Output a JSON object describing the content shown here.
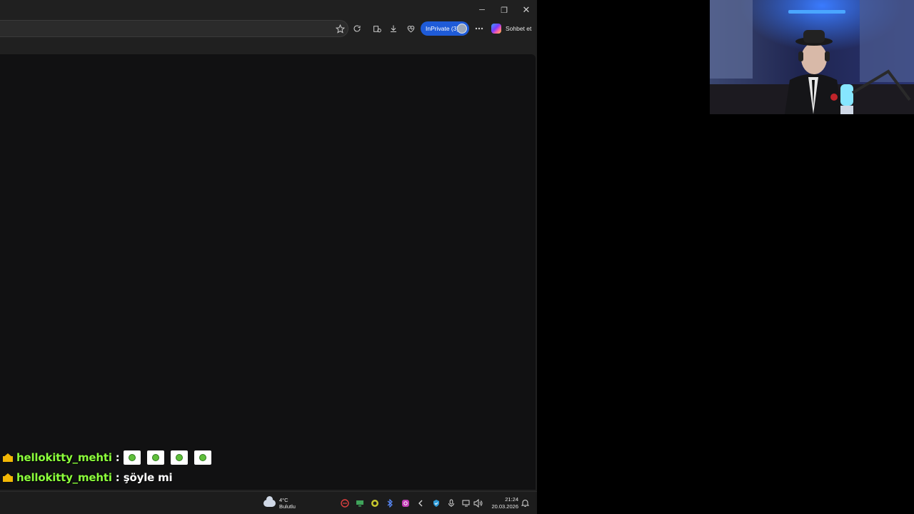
{
  "browser": {
    "window_controls": {
      "minimize": "─",
      "maximize": "❐",
      "close": "✕"
    },
    "toolbar": {
      "inprivate_label": "InPrivate (3)",
      "chat_label": "Sohbet et",
      "icons": [
        "favorite-star-icon",
        "refresh-ext-icon",
        "collections-icon",
        "download-icon",
        "heart-pulse-icon",
        "more-icon"
      ]
    }
  },
  "chat": {
    "messages": [
      {
        "username": "hellokitty_mehti",
        "separator": ":",
        "emote_count": 4
      },
      {
        "username": "hellokitty_mehti",
        "separator": ":",
        "text": "şöyle mi"
      }
    ]
  },
  "taskbar": {
    "weather": {
      "temp": "4°C",
      "condition": "Bulutlu"
    },
    "clock": {
      "time": "21:24",
      "date": "20.03.2026"
    }
  },
  "colors": {
    "username": "#8cff3c",
    "inprivate": "#1e5bd8",
    "crown": "#f2b705"
  }
}
